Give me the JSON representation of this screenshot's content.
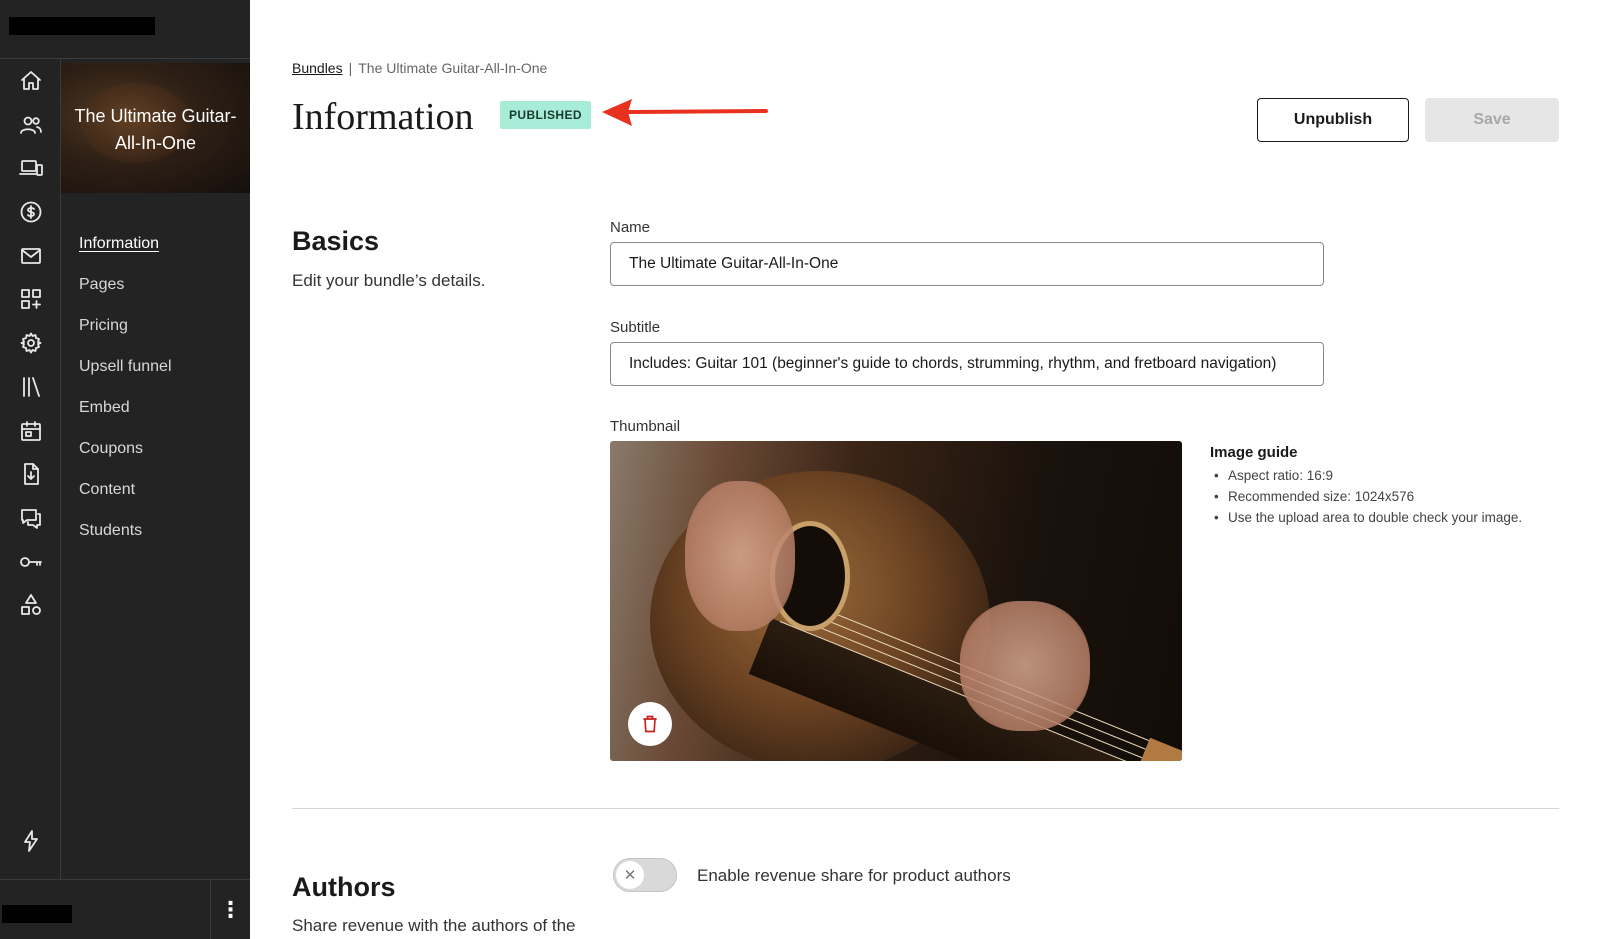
{
  "sidebar": {
    "rail_icons": [
      "home-icon",
      "users-icon",
      "devices-icon",
      "dollar-icon",
      "mail-icon",
      "apps-add-icon",
      "gear-icon",
      "library-icon",
      "calendar-icon",
      "download-file-icon",
      "chat-icon",
      "key-icon",
      "shapes-icon",
      "lightning-icon"
    ],
    "product_title": "The Ultimate Guitar-All-In-One",
    "nav_items": [
      {
        "label": "Information",
        "active": true
      },
      {
        "label": "Pages"
      },
      {
        "label": "Pricing"
      },
      {
        "label": "Upsell funnel"
      },
      {
        "label": "Embed"
      },
      {
        "label": "Coupons"
      },
      {
        "label": "Content"
      },
      {
        "label": "Students"
      }
    ],
    "more_icon": "kebab-icon"
  },
  "header": {
    "breadcrumb_root": "Bundles",
    "breadcrumb_separator": "|",
    "breadcrumb_current": "The Ultimate Guitar-All-In-One",
    "title": "Information",
    "status_badge": "PUBLISHED",
    "badge_color": "#a6ecd6",
    "unpublish_label": "Unpublish",
    "save_label": "Save"
  },
  "basics": {
    "title": "Basics",
    "description": "Edit your bundle’s details.",
    "name_label": "Name",
    "name_value": "The Ultimate Guitar-All-In-One",
    "subtitle_label": "Subtitle",
    "subtitle_value": "Includes: Guitar 101 (beginner's guide to chords, strumming, rhythm, and fretboard navigation)",
    "thumbnail_label": "Thumbnail",
    "image_guide": {
      "title": "Image guide",
      "items": [
        "Aspect ratio: 16:9",
        "Recommended size: 1024x576",
        "Use the upload area to double check your image."
      ]
    }
  },
  "authors": {
    "title": "Authors",
    "description": "Share revenue with the authors of the products within this bundle.",
    "toggle_label": "Enable revenue share for product authors",
    "toggle_on": false
  },
  "annotation_arrow_color": "#e8311f"
}
